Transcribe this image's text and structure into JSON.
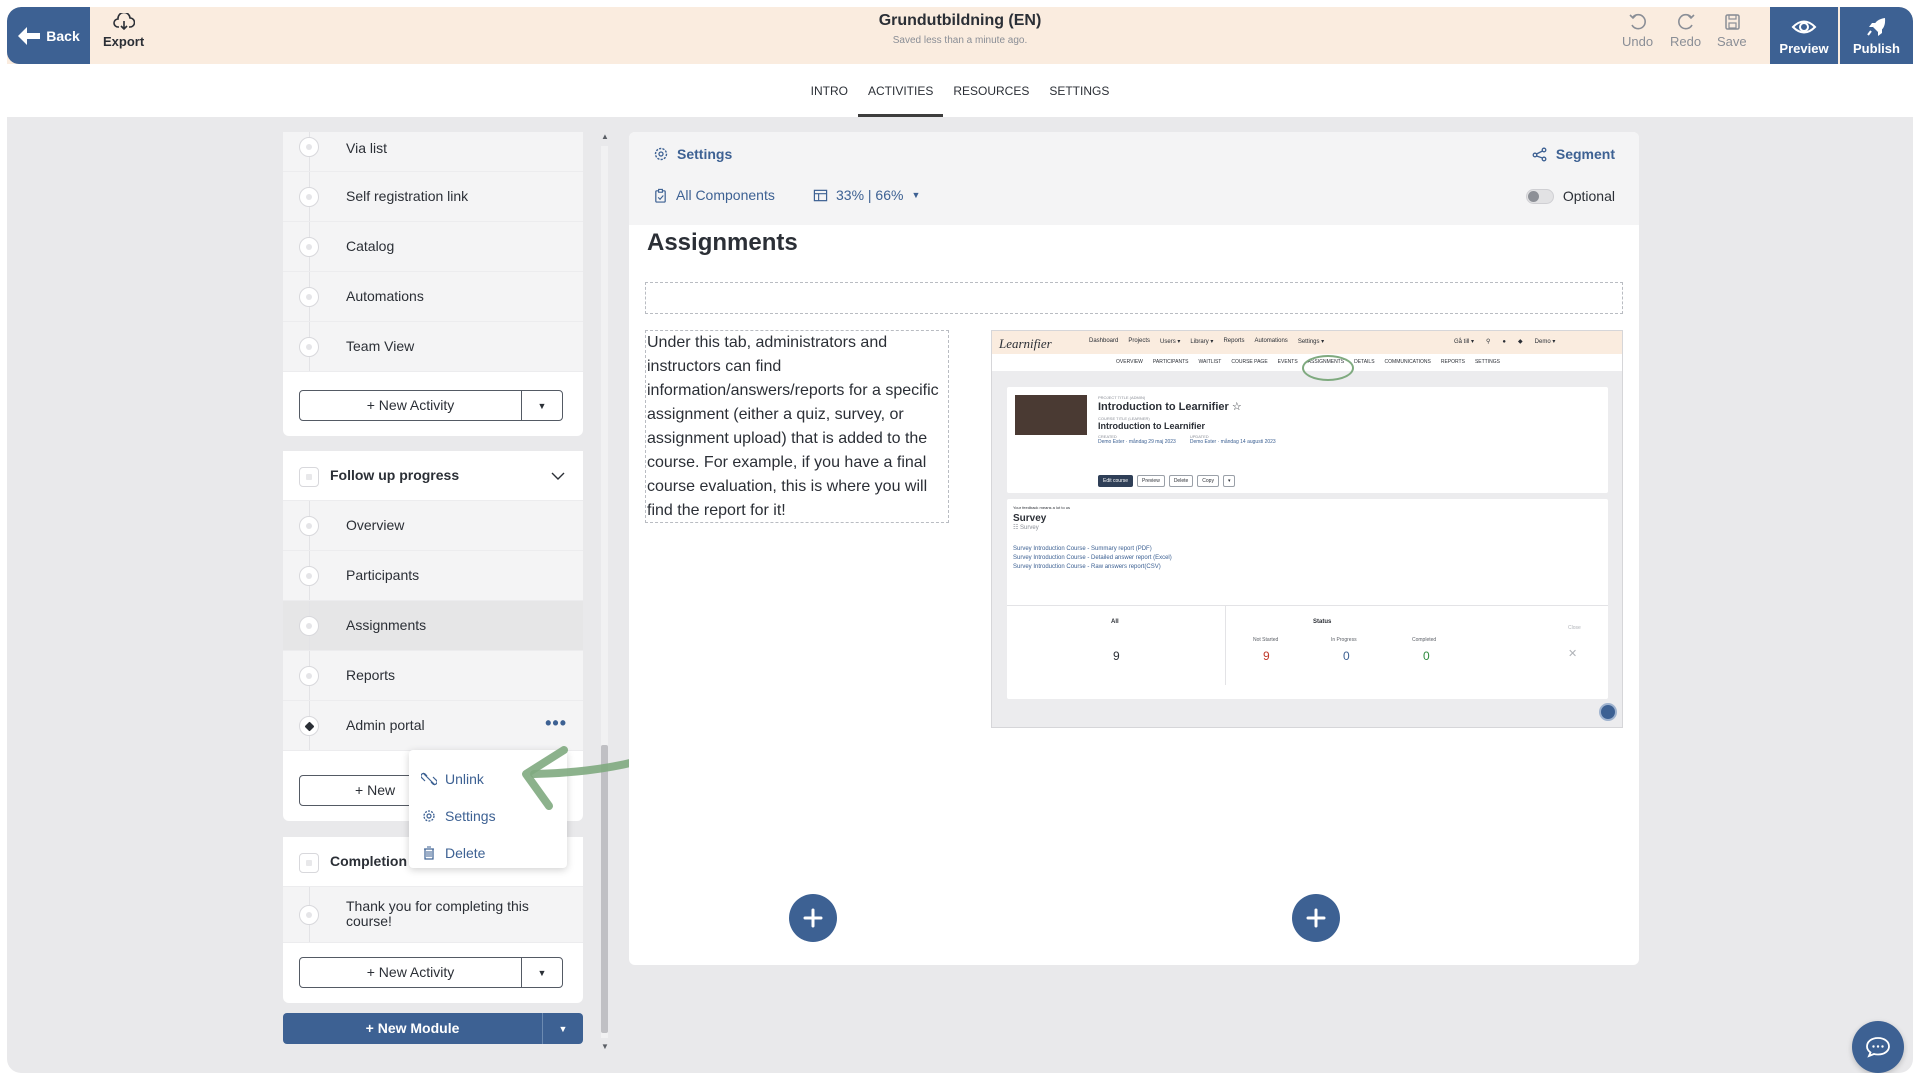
{
  "topbar": {
    "back_label": "Back",
    "export_label": "Export",
    "title": "Grundutbildning (EN)",
    "saved_status": "Saved less than a minute ago.",
    "undo_label": "Undo",
    "redo_label": "Redo",
    "save_label": "Save",
    "preview_label": "Preview",
    "publish_label": "Publish"
  },
  "tabs": [
    {
      "label": "INTRO"
    },
    {
      "label": "ACTIVITIES"
    },
    {
      "label": "RESOURCES"
    },
    {
      "label": "SETTINGS"
    }
  ],
  "active_tab": "ACTIVITIES",
  "module1": {
    "items": [
      "Via list",
      "Self registration link",
      "Catalog",
      "Automations",
      "Team View"
    ],
    "new_activity": "New Activity"
  },
  "module2": {
    "title": "Follow up progress",
    "items": [
      "Overview",
      "Participants",
      "Assignments",
      "Reports",
      "Admin portal"
    ],
    "new_activity_partial": "New"
  },
  "module3": {
    "title_partial": "Completion",
    "items": [
      "Thank you for completing this course!"
    ],
    "new_activity": "New Activity"
  },
  "new_module_label": "New Module",
  "context_menu": {
    "unlink": "Unlink",
    "settings": "Settings",
    "delete": "Delete"
  },
  "panel": {
    "settings_label": "Settings",
    "segment_label": "Segment",
    "all_components_label": "All Components",
    "layout_label": "33% | 66%",
    "optional_label": "Optional",
    "heading": "Assignments",
    "body_text": "Under this tab, administrators and instructors can find information/answers/reports for a specific assignment (either a quiz, survey, or assignment upload) that is added to the course. For example, if you have a final course evaluation, this is where you will find the report for it!"
  },
  "embedded_screenshot": {
    "logo": "Learnifier",
    "nav": [
      "Dashboard",
      "Projects",
      "Users ▾",
      "Library ▾",
      "Reports",
      "Automations",
      "Settings ▾"
    ],
    "goto": "Gå till ▾",
    "user": "Demo ▾",
    "tabs": [
      "OVERVIEW",
      "PARTICIPANTS",
      "WAITLIST",
      "COURSE PAGE",
      "EVENTS",
      "ASSIGNMENTS",
      "DETAILS",
      "COMMUNICATIONS",
      "REPORTS",
      "SETTINGS"
    ],
    "project_label": "PROJECT TITLE (ADMIN)",
    "project_title": "Introduction to Learnifier",
    "course_label": "COURSE TITLE (LEARNER)",
    "course_title": "Introduction to Learnifier",
    "created_label": "CREATED",
    "created_value": "Demo Ester · måndag 29 maj 2023",
    "updated_label": "UPDATED",
    "updated_value": "Demo Ester · måndag 14 augusti 2023",
    "buttons": [
      "Edit course",
      "Preview",
      "Delete",
      "Copy",
      "▾"
    ],
    "feedback_label": "Your feedback means a lot to us",
    "survey_title": "Survey",
    "survey_sub": "Survey",
    "links": [
      "Survey Introduction Course - Summary report (PDF)",
      "Survey Introduction Course - Detailed answer report (Excel)",
      "Survey Introduction Course - Raw answers report(CSV)"
    ],
    "all_label": "All",
    "all_value": "9",
    "status_label": "Status",
    "close_label": "Close",
    "not_started_label": "Not Started",
    "not_started_value": "9",
    "in_progress_label": "In Progress",
    "in_progress_value": "0",
    "completed_label": "Completed",
    "completed_value": "0"
  },
  "colors": {
    "brand": "#3d6193",
    "topbar_bg": "#faecdf",
    "arrow": "#7faa7f"
  }
}
